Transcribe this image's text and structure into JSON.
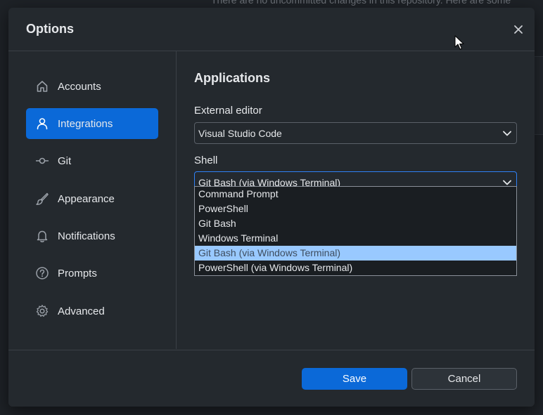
{
  "background": {
    "notice_text": "There are no uncommitted changes in this repository. Here are some"
  },
  "dialog": {
    "title": "Options",
    "close_icon": "close-icon"
  },
  "sidebar": {
    "items": [
      {
        "label": "Accounts",
        "icon": "home-icon",
        "active": false
      },
      {
        "label": "Integrations",
        "icon": "person-icon",
        "active": true
      },
      {
        "label": "Git",
        "icon": "git-commit-icon",
        "active": false
      },
      {
        "label": "Appearance",
        "icon": "paintbrush-icon",
        "active": false
      },
      {
        "label": "Notifications",
        "icon": "bell-icon",
        "active": false
      },
      {
        "label": "Prompts",
        "icon": "question-icon",
        "active": false
      },
      {
        "label": "Advanced",
        "icon": "gear-icon",
        "active": false
      }
    ]
  },
  "content": {
    "section_title": "Applications",
    "external_editor": {
      "label": "External editor",
      "value": "Visual Studio Code"
    },
    "shell": {
      "label": "Shell",
      "value": "Git Bash (via Windows Terminal)",
      "options": [
        "Command Prompt",
        "PowerShell",
        "Git Bash",
        "Windows Terminal",
        "Git Bash (via Windows Terminal)",
        "PowerShell (via Windows Terminal)"
      ],
      "highlighted_index": 4
    }
  },
  "footer": {
    "save_label": "Save",
    "cancel_label": "Cancel"
  },
  "colors": {
    "accent": "#0b69d8",
    "highlight": "#99c9ff",
    "dialog_bg": "#24292e"
  }
}
